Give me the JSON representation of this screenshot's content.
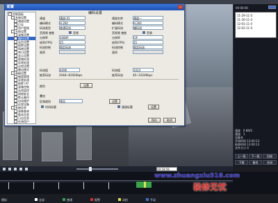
{
  "dialog": {
    "title": "配置",
    "tree": [
      {
        "label": "控制面板",
        "level": 0
      },
      {
        "label": "系统设置",
        "level": 1
      },
      {
        "label": "通道设置",
        "level": 2
      },
      {
        "label": "日志",
        "level": 2
      },
      {
        "label": "用户管理",
        "level": 2
      },
      {
        "label": "本地设置",
        "level": 1
      },
      {
        "label": "录像设置",
        "level": 2
      },
      {
        "label": "编码设置",
        "level": 2,
        "selected": true
      },
      {
        "label": "云台设置",
        "level": 2
      },
      {
        "label": "报警设置",
        "level": 2
      },
      {
        "label": "网络设置",
        "level": 2
      },
      {
        "label": "串口设置",
        "level": 2
      },
      {
        "label": "显示设置",
        "level": 2
      },
      {
        "label": "视频检测",
        "level": 2
      },
      {
        "label": "异常处理",
        "level": 2
      },
      {
        "label": "远程设置",
        "level": 2
      },
      {
        "label": "输出模式",
        "level": 2
      },
      {
        "label": "高级设置",
        "level": 1
      },
      {
        "label": "磁盘管理",
        "level": 2
      },
      {
        "label": "异常处理",
        "level": 2
      },
      {
        "label": "报警 I/O",
        "level": 2
      },
      {
        "label": "录像控制",
        "level": 2
      },
      {
        "label": "无线监控",
        "level": 2
      },
      {
        "label": "网络安全",
        "level": 2
      },
      {
        "label": "默认备份",
        "level": 2
      },
      {
        "label": "自动维护",
        "level": 2
      },
      {
        "label": "远程设备",
        "level": 2
      },
      {
        "label": "系统信息",
        "level": 1
      },
      {
        "label": "录像查询",
        "level": 2
      },
      {
        "label": "版本信息",
        "level": 2
      },
      {
        "label": "日志信息",
        "level": 2
      },
      {
        "label": "在线用户",
        "level": 2
      }
    ],
    "main_header": "编码设置",
    "left_col": {
      "channel": {
        "label": "通道",
        "value": "通道-01"
      },
      "codec": {
        "label": "编码模式",
        "value": "H.264"
      },
      "stream_type": {
        "label": "码流类型",
        "value": "普通码流"
      },
      "av_label": "音视频 使能",
      "video_checked": "音频",
      "resolution": {
        "label": "分辨率",
        "value": "1080P"
      },
      "fps": {
        "label": "帧率(FPS)",
        "value": "25"
      },
      "bitrate_ctrl": {
        "label": "码流控制",
        "value": "限定码流"
      },
      "quality": {
        "label": "画质",
        "value": ""
      },
      "bitrate": {
        "label": "码流值",
        "value": "4096"
      },
      "recommend": {
        "label": "推荐码流",
        "value": "2048~8192Kbps"
      }
    },
    "right_col": {
      "channel_name": {
        "label": "通道名称",
        "value": "通道一"
      },
      "codec": {
        "label": "编码模式",
        "value": "H.264"
      },
      "ext_stream": {
        "label": "扩展码流",
        "value": "辅码流"
      },
      "av_label": "音视频 使能",
      "video_checked": "音频",
      "resolution": {
        "label": "分辨率",
        "value": "CIF"
      },
      "fps": {
        "label": "帧率(FPS)",
        "value": "25"
      },
      "bitrate_ctrl": {
        "label": "码流控制",
        "value": "限定码流"
      },
      "quality": {
        "label": "画质",
        "value": ""
      },
      "bitrate": {
        "label": "码流值",
        "value": "1024"
      },
      "recommend": {
        "label": "推荐码流",
        "value": "40~1024Kbps"
      }
    },
    "color_label": "颜色",
    "color_button": "设置",
    "overlay_label": "叠加",
    "region_cover": {
      "label": "区域遮挡",
      "value": "预览"
    },
    "time_title": "时间标题",
    "channel_title": "通道标题",
    "set_button_1": "设置",
    "set_button_2": "设置",
    "save_button": "保存",
    "cancel_button": "取消"
  },
  "side": {
    "header": "00:00:00",
    "items": [
      {
        "label": "11-29-11",
        "value": "0"
      },
      {
        "label": "11-30-11",
        "value": "0"
      },
      {
        "label": "12-01-11",
        "value": "0"
      },
      {
        "label": "12-02-11",
        "value": "0"
      }
    ],
    "info": [
      {
        "label": "速度",
        "value": "0 KB/S"
      },
      {
        "label": "通道",
        "value": "1"
      },
      {
        "label": "设备名",
        "value": ""
      },
      {
        "label": "开始时间",
        "value": "13:00:13"
      },
      {
        "label": "结束时间",
        "value": "13:00:13"
      },
      {
        "label": "文件大小",
        "value": "0"
      }
    ],
    "buttons": [
      "上一段",
      "下一段",
      "回放",
      "下载",
      "备份",
      "关闭"
    ]
  },
  "player": {
    "time": "19:18:56"
  },
  "legend": {
    "label_left": "模拟",
    "types": [
      "全部",
      "普通",
      "报警",
      "动检",
      "手动"
    ]
  },
  "watermark": {
    "url": "www.zhuangxiu518.com",
    "cn": "装修无忧"
  }
}
